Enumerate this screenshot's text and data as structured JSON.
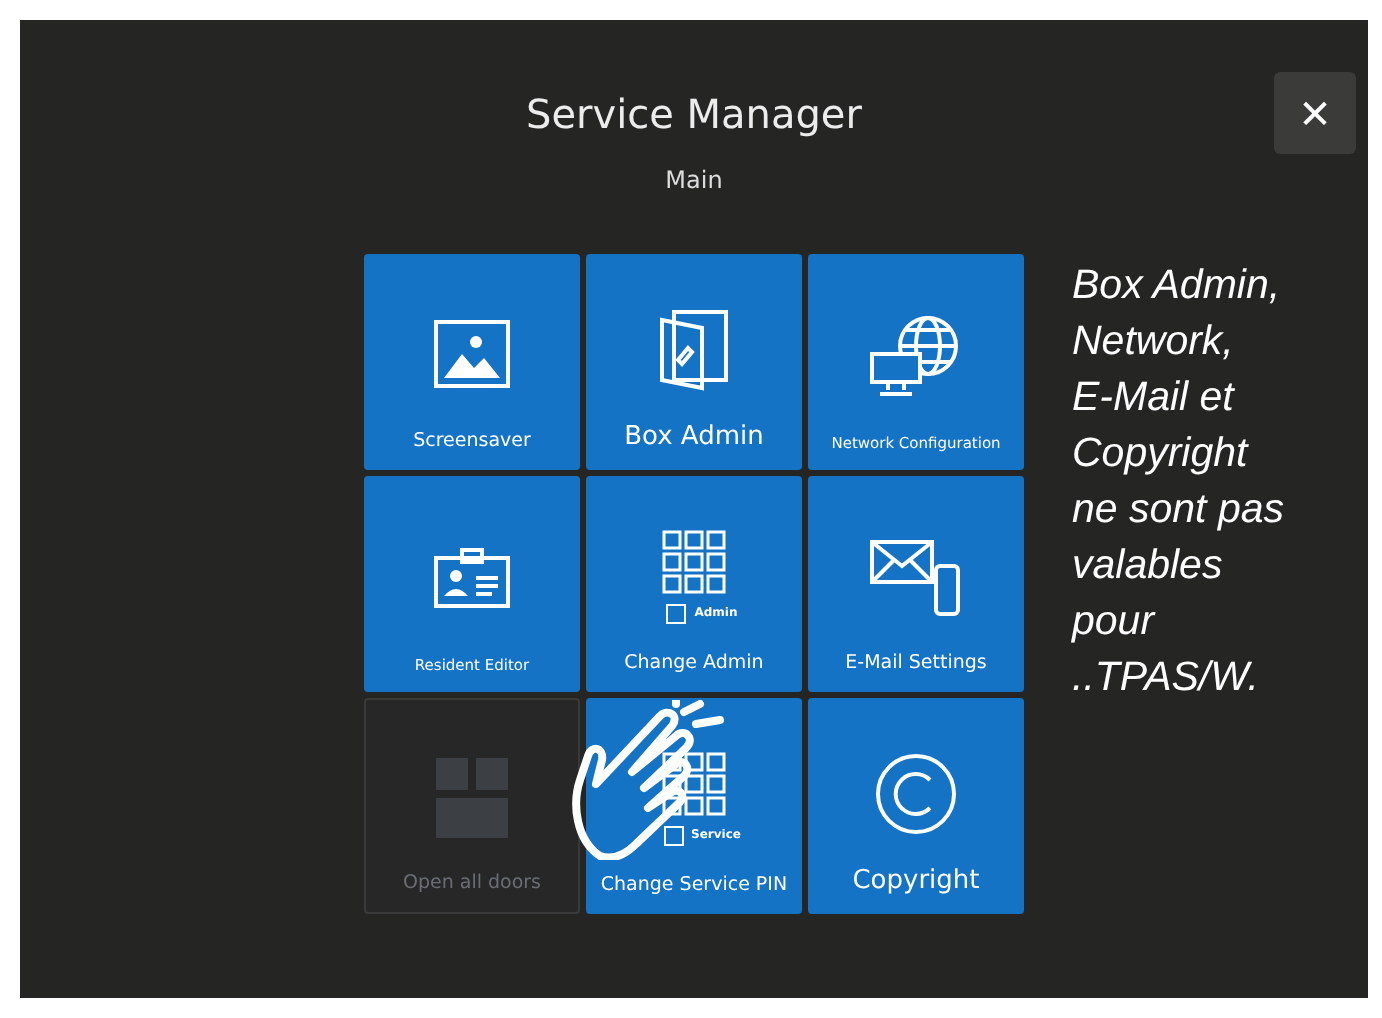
{
  "window": {
    "title": "Service Manager",
    "subtitle": "Main",
    "close": "✕"
  },
  "tiles": [
    {
      "label": "Screensaver",
      "kind": "picture",
      "disabled": false
    },
    {
      "label": "Box Admin",
      "kind": "book",
      "disabled": false
    },
    {
      "label": "Network Configuration",
      "kind": "network",
      "disabled": false
    },
    {
      "label": "Resident Editor",
      "kind": "badge",
      "disabled": false
    },
    {
      "label": "Change Admin",
      "kind": "keypad",
      "icon_label": "Admin",
      "disabled": false
    },
    {
      "label": "E-Mail Settings",
      "kind": "mail",
      "disabled": false
    },
    {
      "label": "Open all doors",
      "kind": "doors",
      "disabled": true
    },
    {
      "label": "Change Service PIN",
      "kind": "keypad",
      "icon_label": "Service",
      "disabled": false
    },
    {
      "label": "Copyright",
      "kind": "copyright",
      "disabled": false
    }
  ],
  "note": "Box Admin,\nNetwork,\nE-Mail et\nCopyright\nne sont pas\nvalables\npour\n..TPAS/W."
}
